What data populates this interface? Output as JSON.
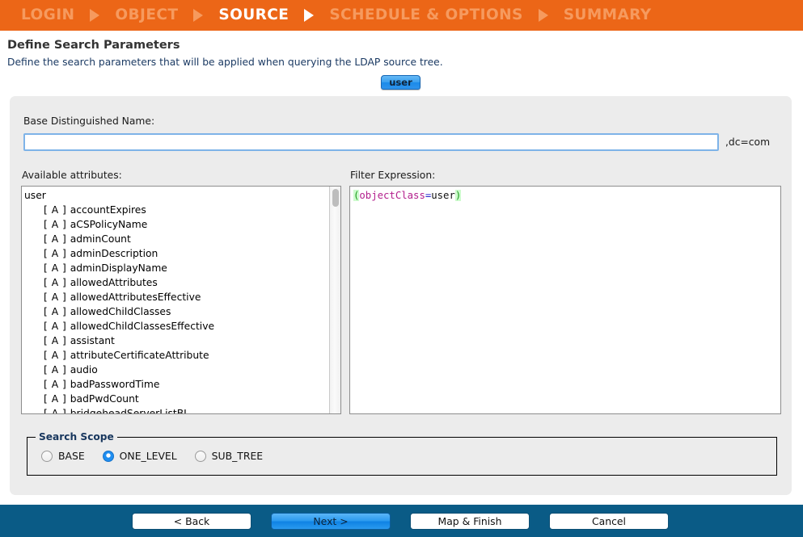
{
  "wizard": {
    "steps": [
      {
        "label": "LOGIN",
        "active": false
      },
      {
        "label": "OBJECT",
        "active": false
      },
      {
        "label": "SOURCE",
        "active": true
      },
      {
        "label": "SCHEDULE & OPTIONS",
        "active": false
      },
      {
        "label": "SUMMARY",
        "active": false
      }
    ]
  },
  "header": {
    "title": "Define Search Parameters",
    "subtitle": "Define the search parameters that will be applied when querying the LDAP source tree."
  },
  "tabs": {
    "active_label": "user"
  },
  "base_dn": {
    "label": "Base Distinguished Name:",
    "value": "",
    "placeholder": "",
    "suffix": ",dc=com"
  },
  "attributes": {
    "label": "Available attributes:",
    "root": "user",
    "marker": "[ A ]",
    "items": [
      "accountExpires",
      "aCSPolicyName",
      "adminCount",
      "adminDescription",
      "adminDisplayName",
      "allowedAttributes",
      "allowedAttributesEffective",
      "allowedChildClasses",
      "allowedChildClassesEffective",
      "assistant",
      "attributeCertificateAttribute",
      "audio",
      "badPasswordTime",
      "badPwdCount",
      "bridgeheadServerListBL"
    ]
  },
  "filter": {
    "label": "Filter Expression:",
    "tokens": {
      "open_paren": "(",
      "attribute": "objectClass",
      "operator": "=",
      "value": "user",
      "close_paren": ")"
    },
    "expression": "(objectClass=user)"
  },
  "search_scope": {
    "legend": "Search Scope",
    "options": [
      {
        "label": "BASE",
        "selected": false
      },
      {
        "label": "ONE_LEVEL",
        "selected": true
      },
      {
        "label": "SUB_TREE",
        "selected": false
      }
    ]
  },
  "footer": {
    "back": "< Back",
    "next": "Next >",
    "map_finish": "Map & Finish",
    "cancel": "Cancel"
  },
  "colors": {
    "header_orange": "#ec6617",
    "header_inactive": "#f69a5e",
    "footer_blue": "#0a5b86",
    "accent_blue": "#1f8ef1",
    "panel_gray": "#ececec",
    "subtitle_navy": "#1b3a63",
    "legend_navy": "#17365d",
    "token_paren": "#1f9f1f",
    "token_attribute": "#b3208d",
    "token_operator": "#2222cc"
  }
}
